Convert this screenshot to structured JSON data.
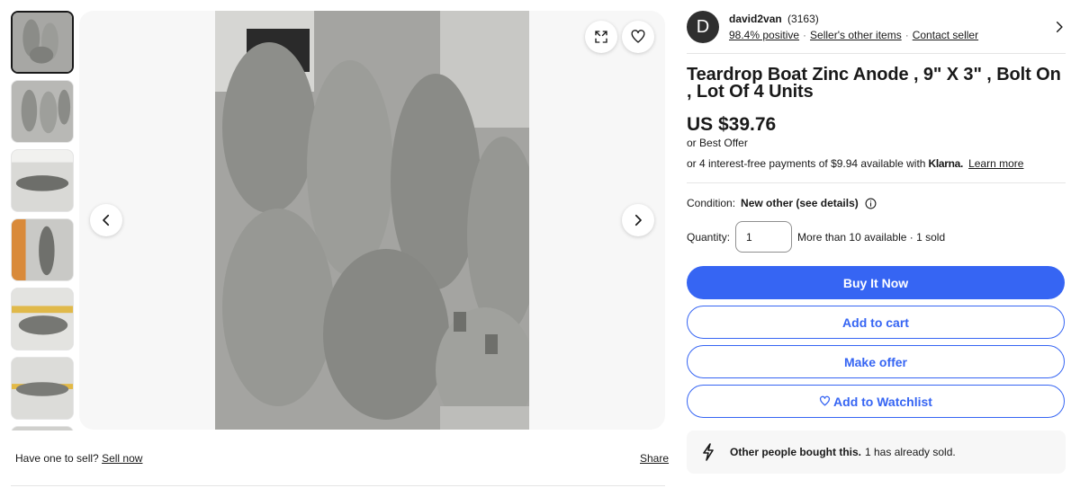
{
  "gallery": {
    "thumbnail_count": 7,
    "main_image_alt": "Picture 1 of 7"
  },
  "listing": {
    "sell_prompt": "Have one to sell?",
    "sell_link": "Sell now",
    "share_label": "Share"
  },
  "seller": {
    "avatar_letter": "D",
    "name": "david2van",
    "feedback_count": "(3163)",
    "positive": "98.4% positive",
    "other_items": "Seller's other items",
    "contact": "Contact seller"
  },
  "item": {
    "title": "Teardrop Boat Zinc Anode , 9\" X 3\" , Bolt On , Lot Of 4 Units",
    "price": "US $39.76",
    "best_offer_prefix": "or",
    "best_offer": "Best Offer",
    "installment_text": "or 4 interest-free payments of $9.94 available with",
    "klarna_logo": "Klarna.",
    "learn_more": "Learn more",
    "condition_label": "Condition:",
    "condition_value": "New other (see details)",
    "quantity_label": "Quantity:",
    "quantity_value": "1",
    "availability": "More than 10 available · 1 sold"
  },
  "actions": {
    "buy_now": "Buy It Now",
    "add_to_cart": "Add to cart",
    "make_offer": "Make offer",
    "watchlist": "Add to Watchlist"
  },
  "social_proof": {
    "strong": "Other people bought this.",
    "rest": "1 has already sold."
  },
  "colors": {
    "accent": "#3665f3",
    "text": "#191919",
    "border": "#e5e5e5"
  }
}
